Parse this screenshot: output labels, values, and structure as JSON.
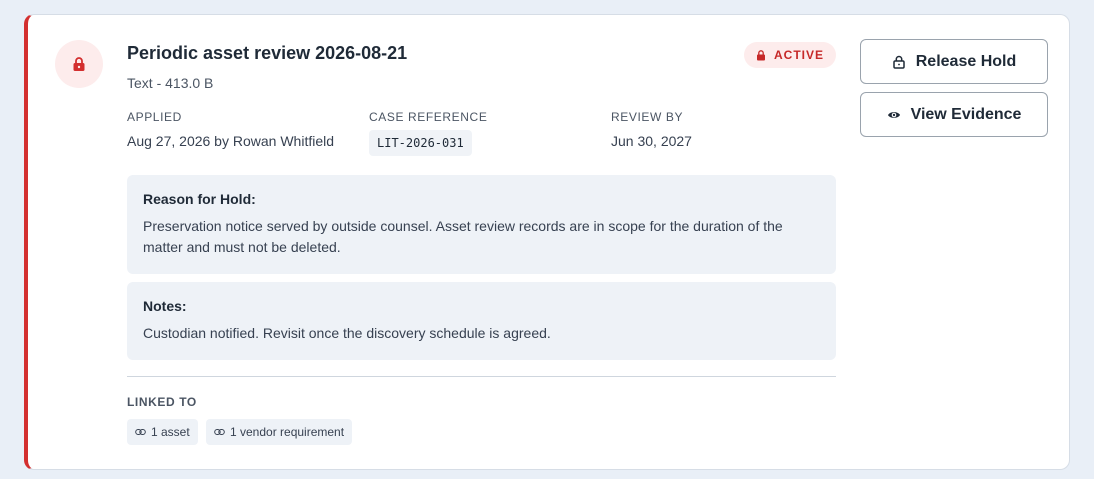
{
  "hold": {
    "title": "Periodic asset review 2026-08-21",
    "subtitle": "Text - 413.0 B",
    "status": "ACTIVE"
  },
  "actions": {
    "release_label": "Release Hold",
    "evidence_label": "View Evidence"
  },
  "meta": {
    "applied_label": "APPLIED",
    "applied_value": "Aug 27, 2026 by Rowan Whitfield",
    "case_label": "CASE REFERENCE",
    "case_value": "LIT-2026-031",
    "review_label": "REVIEW BY",
    "review_value": "Jun 30, 2027"
  },
  "reason": {
    "label": "Reason for Hold:",
    "text": "Preservation notice served by outside counsel. Asset review records are in scope for the duration of the matter and must not be deleted."
  },
  "notes": {
    "label": "Notes:",
    "text": "Custodian notified. Revisit once the discovery schedule is agreed."
  },
  "linked": {
    "label": "LINKED TO",
    "items": [
      "1 asset",
      "1 vendor requirement"
    ]
  },
  "colors": {
    "accent": "#d32f2f",
    "badge_bg": "#fdecec",
    "panel_bg": "#eef2f7"
  },
  "icons": {
    "status": "lock-icon",
    "release": "unlock-icon",
    "evidence": "eye-icon",
    "link": "link-icon"
  }
}
